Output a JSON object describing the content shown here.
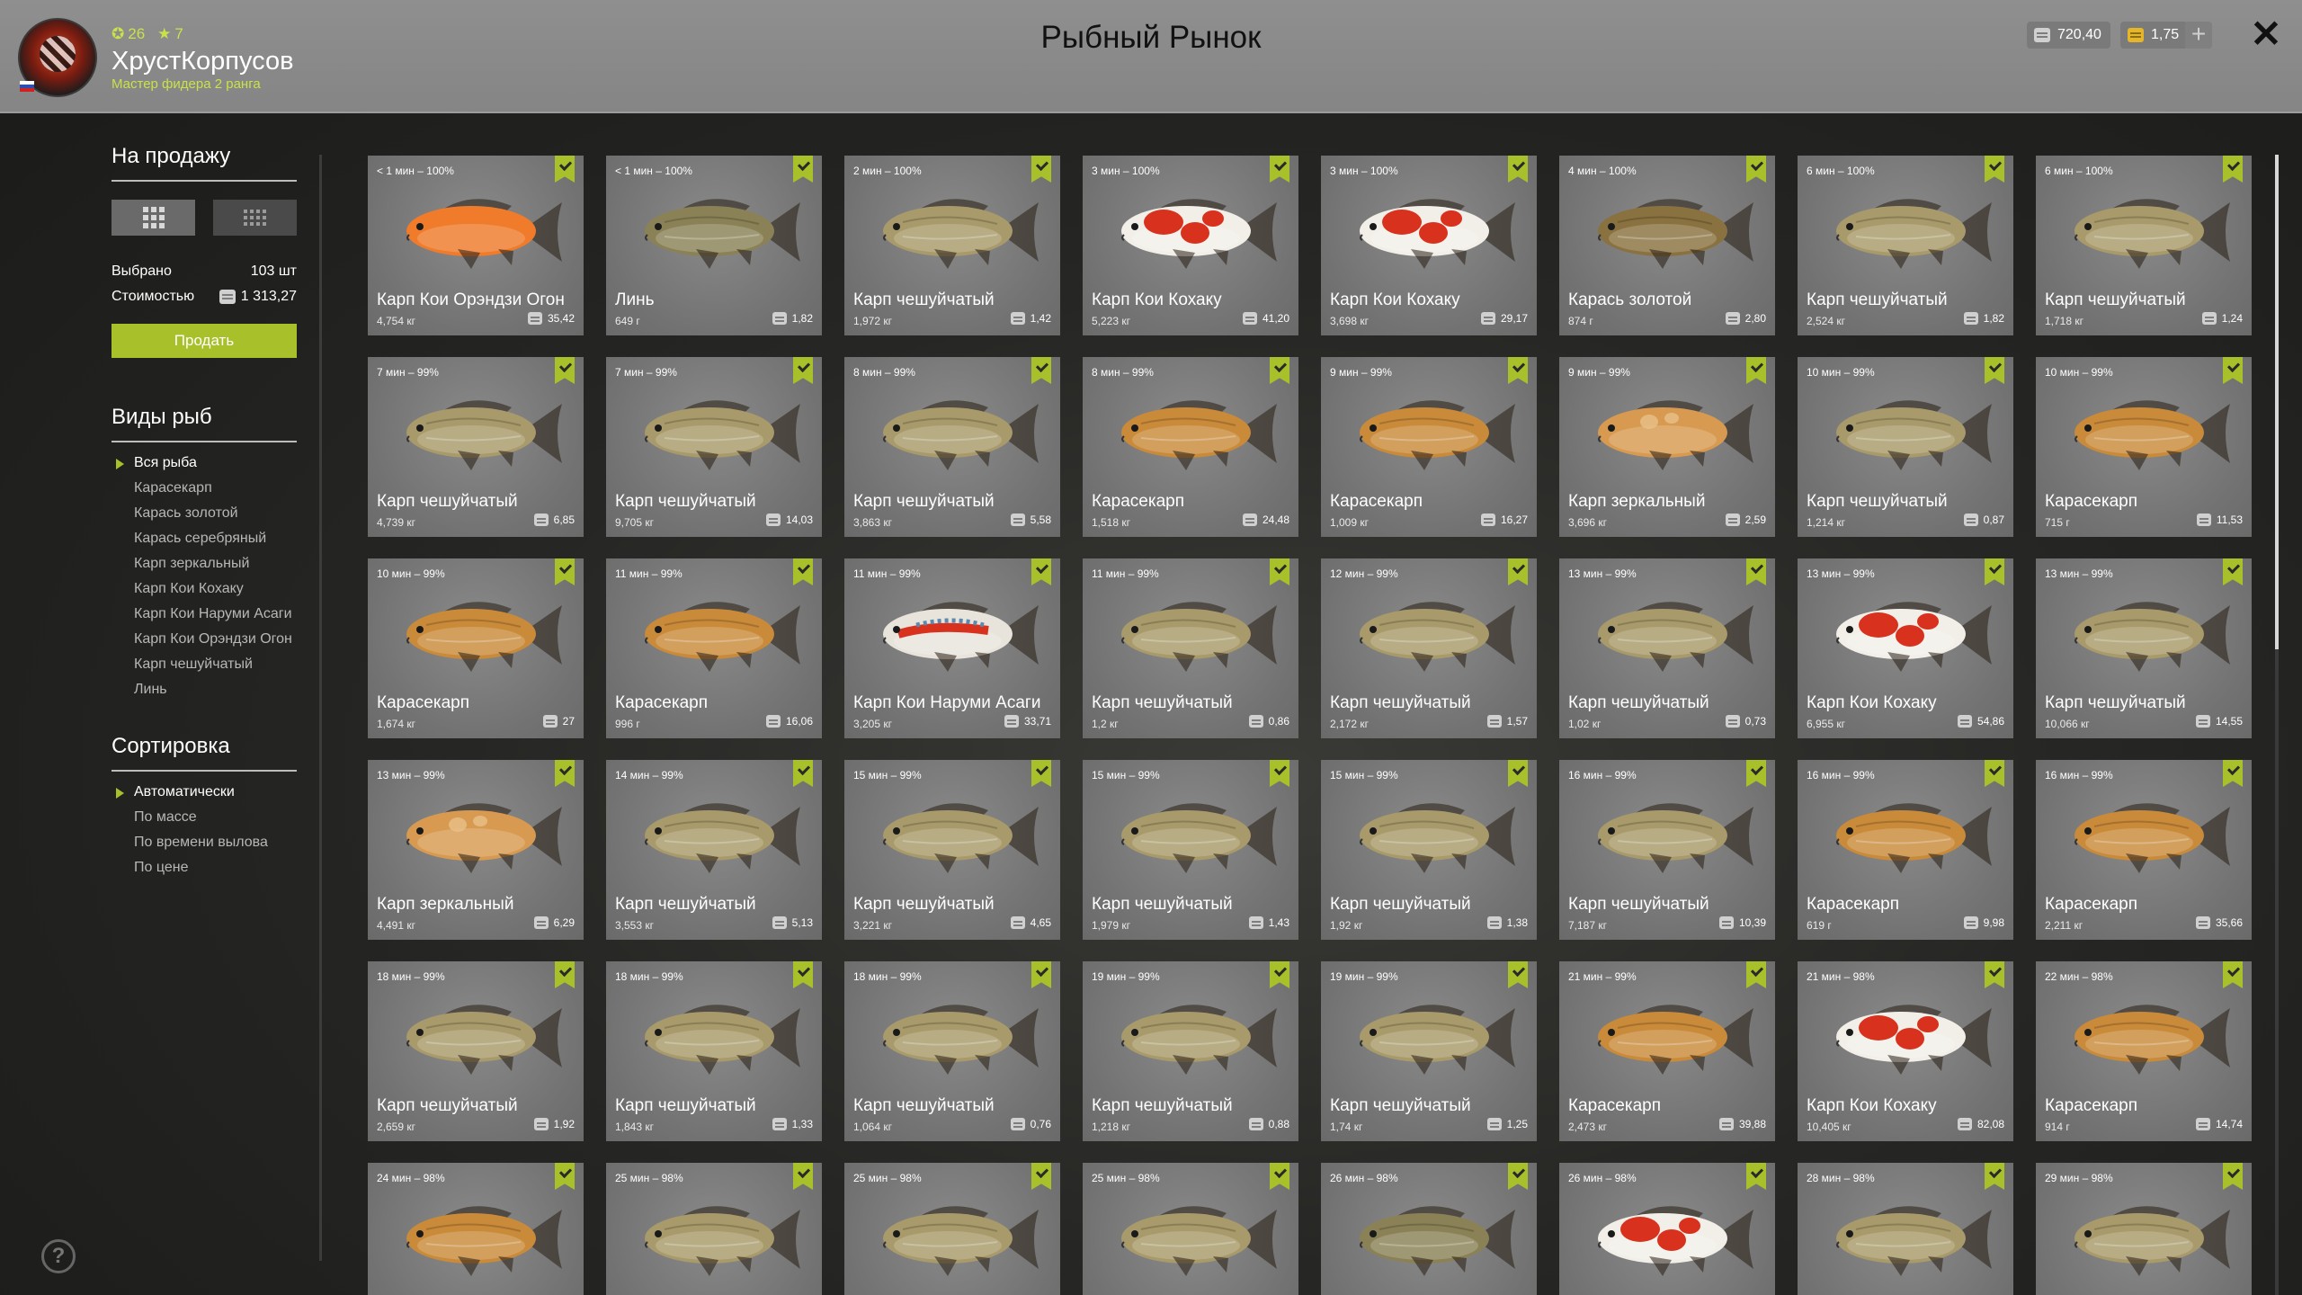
{
  "header": {
    "title": "Рыбный Рынок",
    "player": {
      "level": "26",
      "stars": "7",
      "name": "ХрустКорпусов",
      "rank": "Мастер фидера 2 ранга"
    },
    "silver": "720,40",
    "gold": "1,75",
    "plus": "+",
    "close": "✕"
  },
  "sidebar": {
    "sale_title": "На продажу",
    "selected_label": "Выбрано",
    "selected_value": "103 шт",
    "cost_label": "Стоимостью",
    "cost_value": "1 313,27",
    "sell_button": "Продать",
    "species_title": "Виды рыб",
    "species": [
      "Вся рыба",
      "Карасекарп",
      "Карась золотой",
      "Карась серебряный",
      "Карп зеркальный",
      "Карп Кои Кохаку",
      "Карп Кои Наруми Асаги",
      "Карп Кои Орэндзи Огон",
      "Карп чешуйчатый",
      "Линь"
    ],
    "species_active": 0,
    "sort_title": "Сортировка",
    "sort": [
      "Автоматически",
      "По массе",
      "По времени вылова",
      "По цене"
    ],
    "sort_active": 0,
    "help": "?"
  },
  "fish_cards": [
    {
      "time": "< 1 мин – 100%",
      "name": "Карп Кои Орэндзи Огон",
      "weight": "4,754 кг",
      "price": "35,42",
      "kind": "ogon"
    },
    {
      "time": "< 1 мин – 100%",
      "name": "Линь",
      "weight": "649 г",
      "price": "1,82",
      "kind": "tench"
    },
    {
      "time": "2 мин – 100%",
      "name": "Карп чешуйчатый",
      "weight": "1,972 кг",
      "price": "1,42",
      "kind": "common"
    },
    {
      "time": "3 мин – 100%",
      "name": "Карп Кои Кохаку",
      "weight": "5,223 кг",
      "price": "41,20",
      "kind": "kohaku"
    },
    {
      "time": "3 мин – 100%",
      "name": "Карп Кои Кохаку",
      "weight": "3,698 кг",
      "price": "29,17",
      "kind": "kohaku"
    },
    {
      "time": "4 мин – 100%",
      "name": "Карась золотой",
      "weight": "874 г",
      "price": "2,80",
      "kind": "crucian"
    },
    {
      "time": "6 мин – 100%",
      "name": "Карп чешуйчатый",
      "weight": "2,524 кг",
      "price": "1,82",
      "kind": "common"
    },
    {
      "time": "6 мин – 100%",
      "name": "Карп чешуйчатый",
      "weight": "1,718 кг",
      "price": "1,24",
      "kind": "common"
    },
    {
      "time": "7 мин – 99%",
      "name": "Карп чешуйчатый",
      "weight": "4,739 кг",
      "price": "6,85",
      "kind": "common"
    },
    {
      "time": "7 мин – 99%",
      "name": "Карп чешуйчатый",
      "weight": "9,705 кг",
      "price": "14,03",
      "kind": "common"
    },
    {
      "time": "8 мин – 99%",
      "name": "Карп чешуйчатый",
      "weight": "3,863 кг",
      "price": "5,58",
      "kind": "common"
    },
    {
      "time": "8 мин – 99%",
      "name": "Карасекарп",
      "weight": "1,518 кг",
      "price": "24,48",
      "kind": "hybrid"
    },
    {
      "time": "9 мин – 99%",
      "name": "Карасекарп",
      "weight": "1,009 кг",
      "price": "16,27",
      "kind": "hybrid"
    },
    {
      "time": "9 мин – 99%",
      "name": "Карп зеркальный",
      "weight": "3,696 кг",
      "price": "2,59",
      "kind": "mirror"
    },
    {
      "time": "10 мин – 99%",
      "name": "Карп чешуйчатый",
      "weight": "1,214 кг",
      "price": "0,87",
      "kind": "common"
    },
    {
      "time": "10 мин – 99%",
      "name": "Карасекарп",
      "weight": "715 г",
      "price": "11,53",
      "kind": "hybrid"
    },
    {
      "time": "10 мин – 99%",
      "name": "Карасекарп",
      "weight": "1,674 кг",
      "price": "27",
      "kind": "hybrid"
    },
    {
      "time": "11 мин – 99%",
      "name": "Карасекарп",
      "weight": "996 г",
      "price": "16,06",
      "kind": "hybrid"
    },
    {
      "time": "11 мин – 99%",
      "name": "Карп Кои Наруми Асаги",
      "weight": "3,205 кг",
      "price": "33,71",
      "kind": "asagi"
    },
    {
      "time": "11 мин – 99%",
      "name": "Карп чешуйчатый",
      "weight": "1,2 кг",
      "price": "0,86",
      "kind": "common"
    },
    {
      "time": "12 мин – 99%",
      "name": "Карп чешуйчатый",
      "weight": "2,172 кг",
      "price": "1,57",
      "kind": "common"
    },
    {
      "time": "13 мин – 99%",
      "name": "Карп чешуйчатый",
      "weight": "1,02 кг",
      "price": "0,73",
      "kind": "common"
    },
    {
      "time": "13 мин – 99%",
      "name": "Карп Кои Кохаку",
      "weight": "6,955 кг",
      "price": "54,86",
      "kind": "kohaku"
    },
    {
      "time": "13 мин – 99%",
      "name": "Карп чешуйчатый",
      "weight": "10,066 кг",
      "price": "14,55",
      "kind": "common"
    },
    {
      "time": "13 мин – 99%",
      "name": "Карп зеркальный",
      "weight": "4,491 кг",
      "price": "6,29",
      "kind": "mirror"
    },
    {
      "time": "14 мин – 99%",
      "name": "Карп чешуйчатый",
      "weight": "3,553 кг",
      "price": "5,13",
      "kind": "common"
    },
    {
      "time": "15 мин – 99%",
      "name": "Карп чешуйчатый",
      "weight": "3,221 кг",
      "price": "4,65",
      "kind": "common"
    },
    {
      "time": "15 мин – 99%",
      "name": "Карп чешуйчатый",
      "weight": "1,979 кг",
      "price": "1,43",
      "kind": "common"
    },
    {
      "time": "15 мин – 99%",
      "name": "Карп чешуйчатый",
      "weight": "1,92 кг",
      "price": "1,38",
      "kind": "common"
    },
    {
      "time": "16 мин – 99%",
      "name": "Карп чешуйчатый",
      "weight": "7,187 кг",
      "price": "10,39",
      "kind": "common"
    },
    {
      "time": "16 мин – 99%",
      "name": "Карасекарп",
      "weight": "619 г",
      "price": "9,98",
      "kind": "hybrid"
    },
    {
      "time": "16 мин – 99%",
      "name": "Карасекарп",
      "weight": "2,211 кг",
      "price": "35,66",
      "kind": "hybrid"
    },
    {
      "time": "18 мин – 99%",
      "name": "Карп чешуйчатый",
      "weight": "2,659 кг",
      "price": "1,92",
      "kind": "common"
    },
    {
      "time": "18 мин – 99%",
      "name": "Карп чешуйчатый",
      "weight": "1,843 кг",
      "price": "1,33",
      "kind": "common"
    },
    {
      "time": "18 мин – 99%",
      "name": "Карп чешуйчатый",
      "weight": "1,064 кг",
      "price": "0,76",
      "kind": "common"
    },
    {
      "time": "19 мин – 99%",
      "name": "Карп чешуйчатый",
      "weight": "1,218 кг",
      "price": "0,88",
      "kind": "common"
    },
    {
      "time": "19 мин – 99%",
      "name": "Карп чешуйчатый",
      "weight": "1,74 кг",
      "price": "1,25",
      "kind": "common"
    },
    {
      "time": "21 мин – 99%",
      "name": "Карасекарп",
      "weight": "2,473 кг",
      "price": "39,88",
      "kind": "hybrid"
    },
    {
      "time": "21 мин – 98%",
      "name": "Карп Кои Кохаку",
      "weight": "10,405 кг",
      "price": "82,08",
      "kind": "kohaku"
    },
    {
      "time": "22 мин – 98%",
      "name": "Карасекарп",
      "weight": "914 г",
      "price": "14,74",
      "kind": "hybrid"
    },
    {
      "time": "24 мин – 98%",
      "name": "",
      "weight": "",
      "price": "",
      "kind": "hybrid"
    },
    {
      "time": "25 мин – 98%",
      "name": "",
      "weight": "",
      "price": "",
      "kind": "common"
    },
    {
      "time": "25 мин – 98%",
      "name": "",
      "weight": "",
      "price": "",
      "kind": "common"
    },
    {
      "time": "25 мин – 98%",
      "name": "",
      "weight": "",
      "price": "",
      "kind": "common"
    },
    {
      "time": "26 мин – 98%",
      "name": "",
      "weight": "",
      "price": "",
      "kind": "tench"
    },
    {
      "time": "26 мин – 98%",
      "name": "",
      "weight": "",
      "price": "",
      "kind": "kohaku"
    },
    {
      "time": "28 мин – 98%",
      "name": "",
      "weight": "",
      "price": "",
      "kind": "common"
    },
    {
      "time": "29 мин – 98%",
      "name": "",
      "weight": "",
      "price": "",
      "kind": "common"
    }
  ],
  "fish_colors": {
    "common": "#a89a6a",
    "hybrid": "#c98a3a",
    "mirror": "#d79a50",
    "kohaku": "#f2efe8",
    "ogon": "#f07b2a",
    "tench": "#8a8256",
    "crucian": "#8a7240",
    "asagi": "#e8e4dc"
  },
  "accent_color": "#a8c02a"
}
